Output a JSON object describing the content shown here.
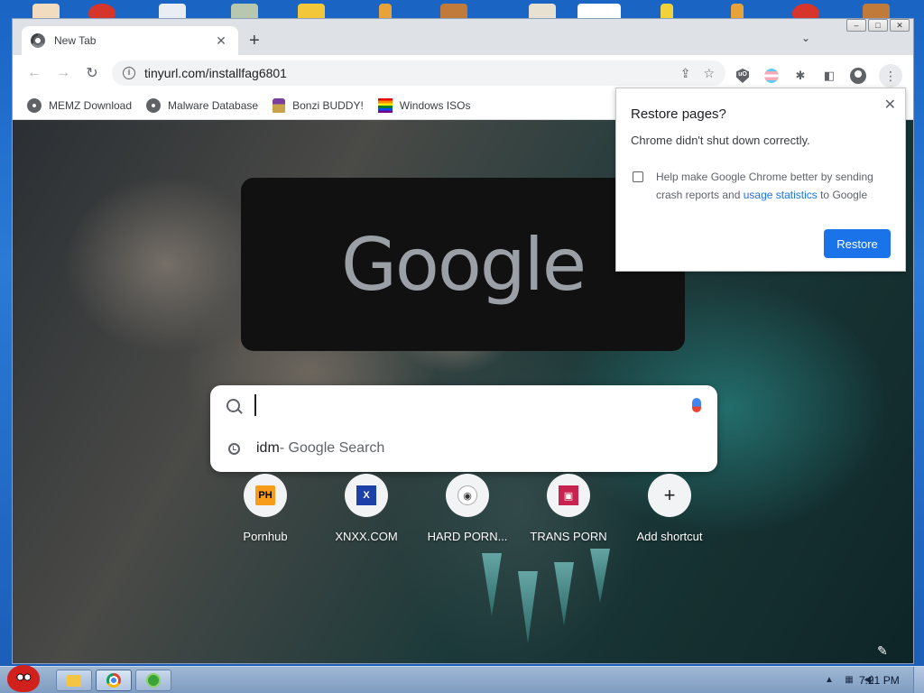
{
  "browser": {
    "tab_title": "New Tab",
    "url": "tinyurl.com/installfag6801",
    "bookmarks": [
      {
        "label": "MEMZ Download",
        "icon": "globe-icon"
      },
      {
        "label": "Malware Database",
        "icon": "globe-icon"
      },
      {
        "label": "Bonzi BUDDY!",
        "icon": "bonzi-icon"
      },
      {
        "label": "Windows ISOs",
        "icon": "rainbow-flag-icon"
      }
    ]
  },
  "newtab": {
    "logo": "Google",
    "search_value": "",
    "suggestion": {
      "query": "idm",
      "suffix": " - Google Search"
    },
    "shortcuts": [
      {
        "label": "Pornhub",
        "icon_text": "PH"
      },
      {
        "label": "XNXX.COM",
        "icon_text": "X"
      },
      {
        "label": "HARD PORN...",
        "icon_text": "◉"
      },
      {
        "label": "TRANS PORN",
        "icon_text": "▣"
      },
      {
        "label": "Add shortcut",
        "icon_text": "+"
      }
    ]
  },
  "restore_popup": {
    "title": "Restore pages?",
    "message": "Chrome didn't shut down correctly.",
    "checkbox_text_1": "Help make Google Chrome better by sending crash reports and ",
    "checkbox_link": "usage statistics",
    "checkbox_text_2": " to Google",
    "button": "Restore"
  },
  "taskbar": {
    "time": "7:21 PM"
  },
  "colors": {
    "accent": "#1a73e8",
    "taskbar": "#9fb7d3"
  }
}
